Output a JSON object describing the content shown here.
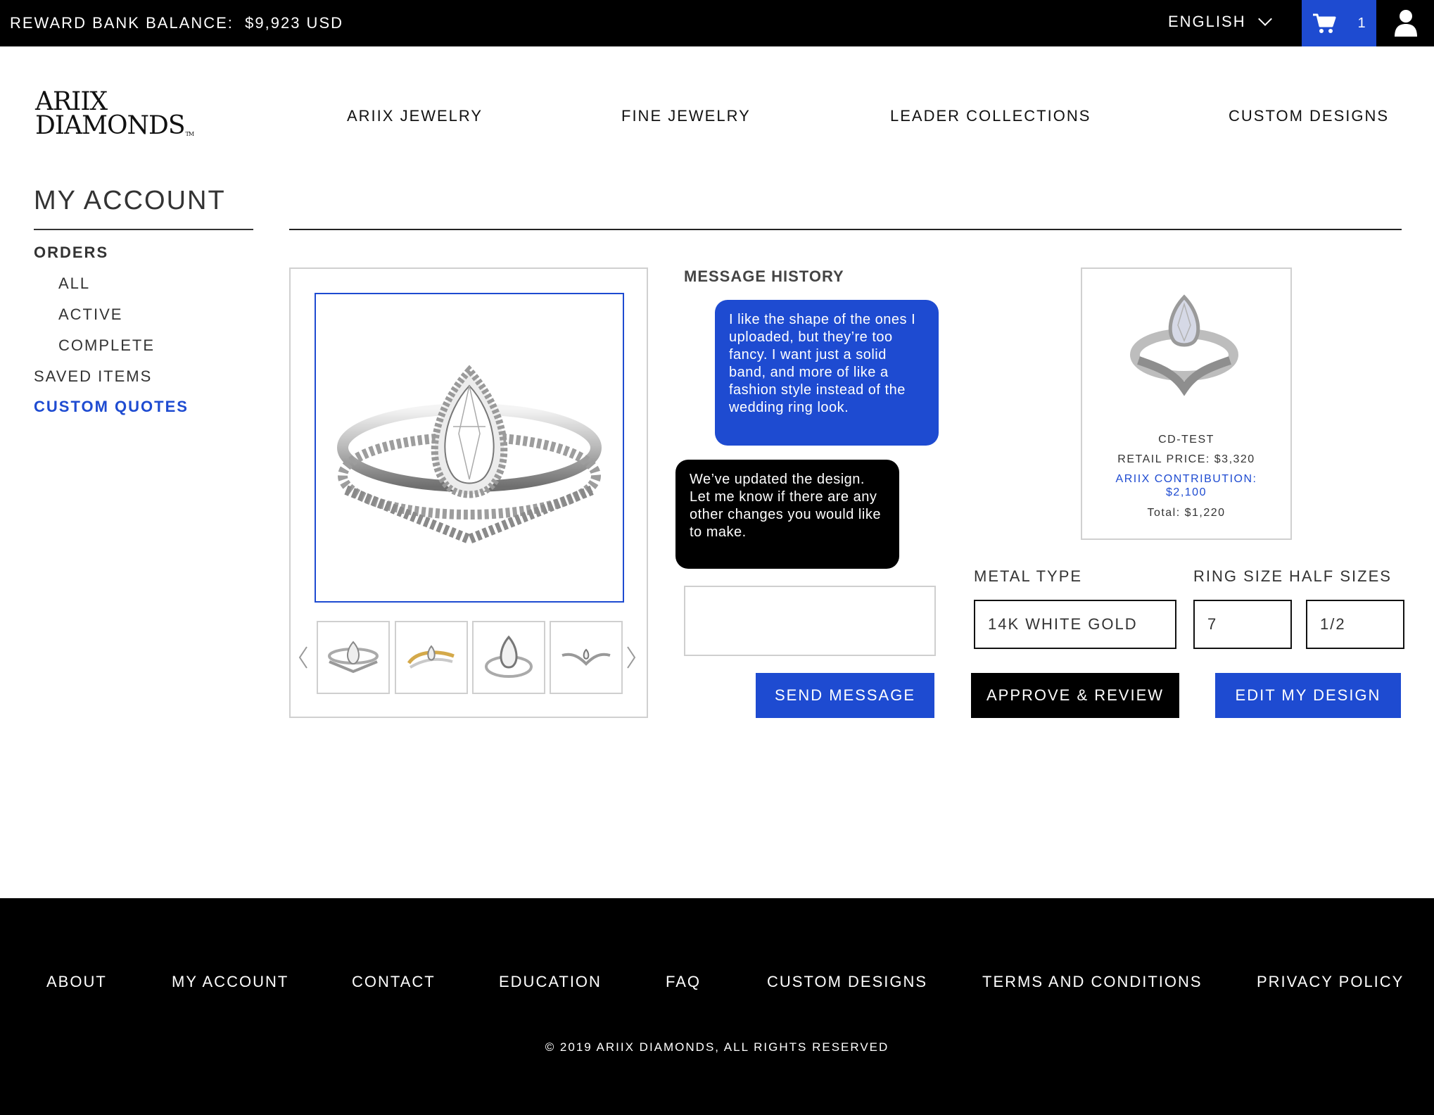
{
  "topbar": {
    "reward_label": "REWARD BANK BALANCE:",
    "reward_value": "$9,923 USD",
    "language": "ENGLISH",
    "cart_count": "1"
  },
  "header": {
    "logo_line1": "ARIIX",
    "logo_line2": "DIAMONDS",
    "logo_tm": "TM",
    "nav": [
      "ARIIX JEWELRY",
      "FINE JEWELRY",
      "LEADER COLLECTIONS",
      "CUSTOM DESIGNS"
    ]
  },
  "account": {
    "title": "MY ACCOUNT",
    "orders": "ORDERS",
    "all": "ALL",
    "active": "ACTIVE",
    "complete": "COMPLETE",
    "saved": "SAVED ITEMS",
    "quotes": "CUSTOM QUOTES"
  },
  "messages": {
    "title": "MESSAGE HISTORY",
    "customer": "I like the shape of the ones I uploaded, but they’re too fancy. I want just a solid band, and more of like a fashion style instead of the wedding ring look.",
    "designer": "We’ve updated the design. Let me know if there are any other changes you would like to make.",
    "input_value": "",
    "send": "SEND MESSAGE"
  },
  "product": {
    "sku": "CD-TEST",
    "retail": "RETAIL PRICE: $3,320",
    "contribution_label": "ARIIX CONTRIBUTION:",
    "contribution_value": "$2,100",
    "total": "Total: $1,220"
  },
  "options": {
    "metal_label": "METAL TYPE",
    "metal_value": "14K WHITE GOLD",
    "ring_label": "RING SIZE",
    "ring_value": "7",
    "half_label": "HALF SIZES",
    "half_value": "1/2"
  },
  "actions": {
    "approve": "APPROVE & REVIEW",
    "edit": "EDIT MY DESIGN"
  },
  "footer": {
    "links": [
      "ABOUT",
      "MY ACCOUNT",
      "CONTACT",
      "EDUCATION",
      "FAQ",
      "CUSTOM DESIGNS",
      "TERMS AND CONDITIONS",
      "PRIVACY POLICY"
    ],
    "copyright": "© 2019 ARIIX DIAMONDS,   ALL RIGHTS RESERVED"
  },
  "colors": {
    "accent": "#1e4bd1",
    "black": "#000000",
    "border": "#d0d0d0"
  },
  "icons": [
    "chevron-down-icon",
    "cart-icon",
    "user-icon",
    "chevron-left-icon",
    "chevron-right-icon",
    "ring-image"
  ]
}
